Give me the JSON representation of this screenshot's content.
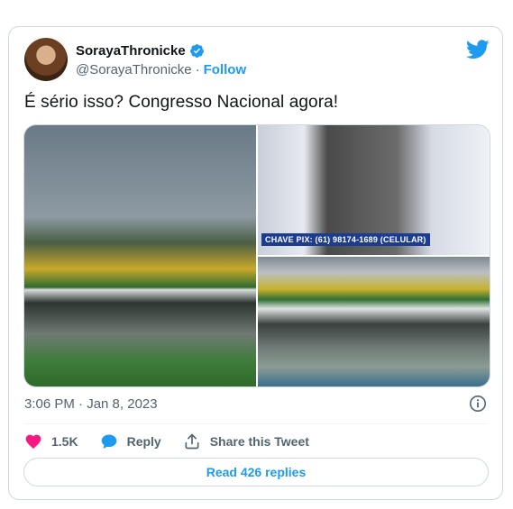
{
  "author": {
    "display_name": "SorayaThronicke",
    "handle": "@SorayaThronicke",
    "separator": "·",
    "follow_label": "Follow"
  },
  "tweet": {
    "text": "É sério isso? Congresso Nacional agora!",
    "timestamp": "3:06 PM · Jan 8, 2023",
    "media_caption": "CHAVE PIX: (61) 98174-1689 (CELULAR)"
  },
  "actions": {
    "likes_count": "1.5K",
    "reply_label": "Reply",
    "share_label": "Share this Tweet"
  },
  "read_replies_label": "Read 426 replies",
  "colors": {
    "accent": "#1d9bf0",
    "like": "#f91880",
    "text": "#0f1419",
    "secondary": "#536471"
  },
  "icons": {
    "verified": "verified-badge-icon",
    "brand": "twitter-bird-icon",
    "info": "info-icon",
    "like": "heart-icon",
    "reply": "speech-bubble-icon",
    "share": "share-arrow-icon"
  }
}
